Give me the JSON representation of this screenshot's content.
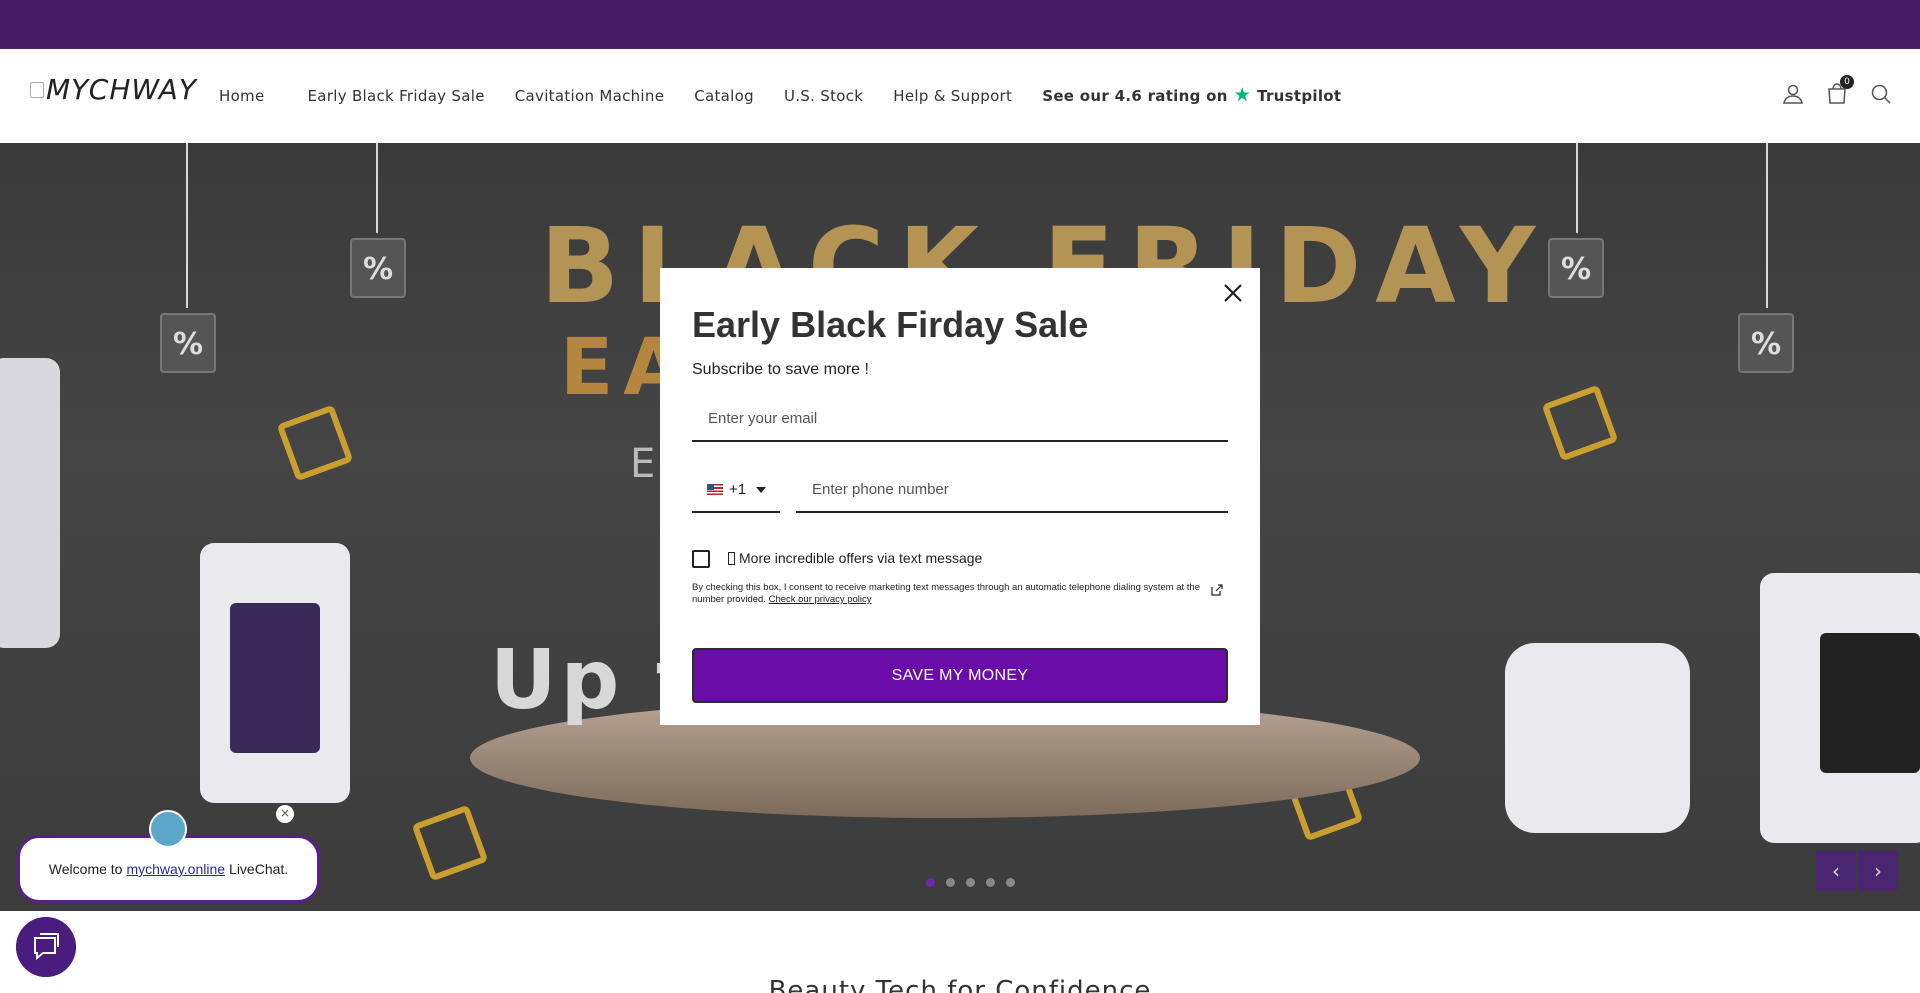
{
  "header": {
    "logo_text": "MYCHWAY",
    "nav": [
      "Home",
      "Early Black Friday Sale",
      "Cavitation Machine",
      "Catalog",
      "U.S. Stock",
      "Help & Support"
    ],
    "trustpilot": {
      "prefix": "See our 4.6 rating on",
      "brand": "Trustpilot"
    },
    "cart_count": "0",
    "icons": [
      "account-icon",
      "cart-icon",
      "search-icon"
    ]
  },
  "hero": {
    "line1": "BLACK FRIDAY",
    "line2": "EARLY SALE",
    "line3": "E                                    y",
    "line4": "Up t                                 OFF",
    "slide_count": 5,
    "active_slide": 1
  },
  "modal": {
    "title": "Early Black Firday Sale",
    "subtitle": "Subscribe to save more !",
    "email_placeholder": "Enter your email",
    "country_code": "+1",
    "phone_placeholder": "Enter phone number",
    "checkbox_label": "More incredible offers via text message",
    "disclaimer": "By checking this box, I consent to receive marketing text messages through an automatic telephone dialing system at the number provided.",
    "privacy_link": "Check our privacy policy",
    "submit_label": "SAVE MY MONEY"
  },
  "section": {
    "title": "Beauty Tech for Confidence"
  },
  "chat": {
    "prefix": "Welcome to",
    "link": "mychway.online",
    "suffix": "LiveChat.",
    "close_glyph": "×"
  },
  "colors": {
    "announce_bar": "#4a1c66",
    "brand_purple": "#6a0ca8",
    "trustpilot_green": "#00b67a"
  }
}
